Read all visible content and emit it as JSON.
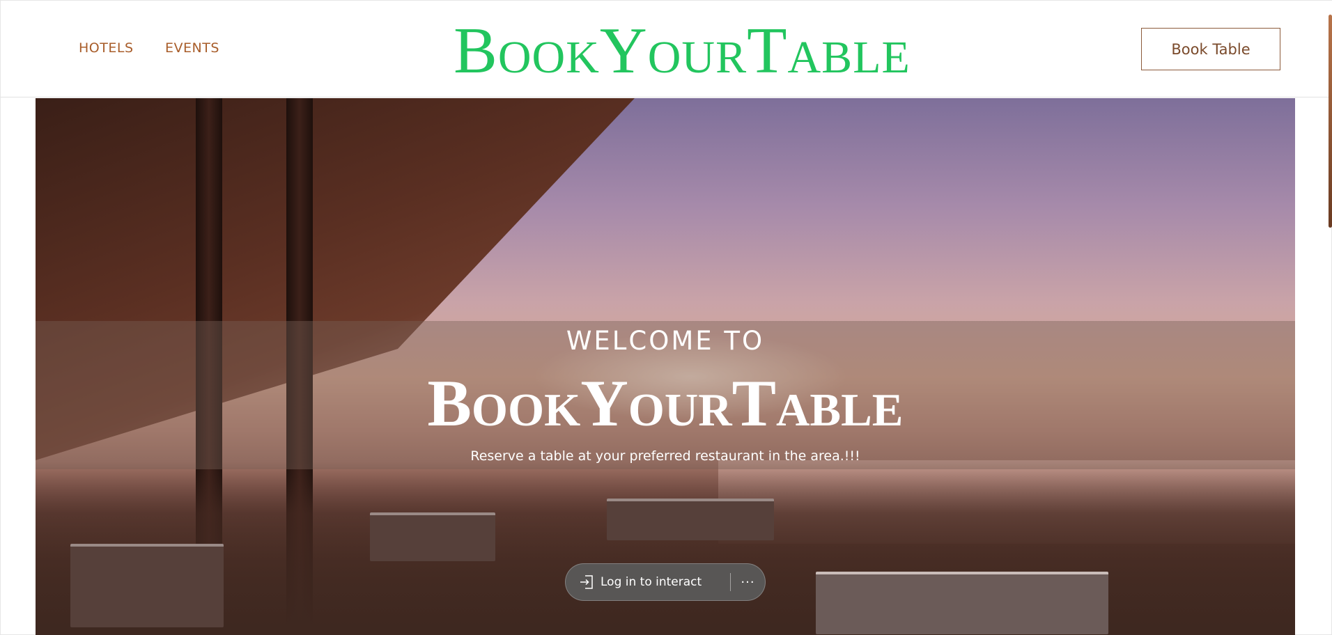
{
  "nav": {
    "hotels": "HOTELS",
    "events": "EVENTS"
  },
  "brand": {
    "logo_text": "BookYourTable"
  },
  "actions": {
    "book_table": "Book Table"
  },
  "hero": {
    "welcome": "WELCOME TO",
    "title": "BookYourTable",
    "subtitle": "Reserve a table at your preferred restaurant in the area.!!!"
  },
  "login_bar": {
    "label": "Log in to interact",
    "icon": "login-arrow-icon",
    "more_icon": "more-dots-icon",
    "more_glyph": "···"
  },
  "colors": {
    "nav_text": "#a85d2a",
    "logo": "#22c55e",
    "button_text": "#7a4a2b",
    "button_border": "#8b5a3a",
    "scrollbar": "#8a4a2a"
  }
}
